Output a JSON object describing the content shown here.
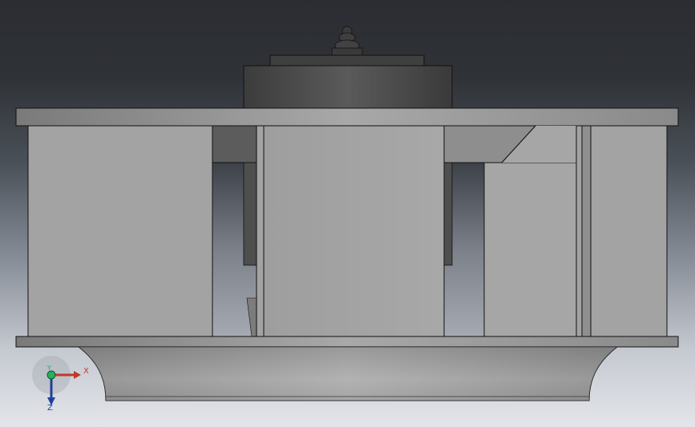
{
  "viewport": {
    "background_top": "#2b2d32",
    "background_bottom": "#e3e5ea"
  },
  "model": {
    "description_icon": "centrifugal-fan-impeller-model",
    "base_color": "#a9a9a9",
    "edge_color": "#111111"
  },
  "triad": {
    "x_label": "X",
    "y_label": "Y",
    "z_label": "Z",
    "x_color": "#c0392b",
    "y_color": "#27ae60",
    "z_color": "#1f3f9a"
  }
}
